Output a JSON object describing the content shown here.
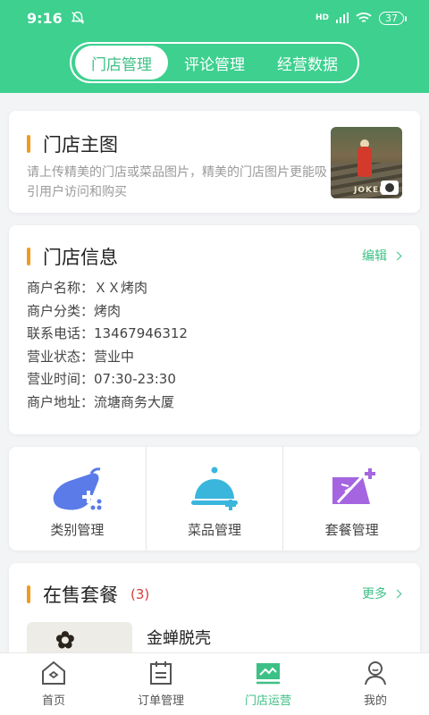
{
  "status_bar": {
    "time": "9:16",
    "battery": "37",
    "network": "HD"
  },
  "header": {
    "tabs": [
      {
        "label": "门店管理",
        "active": true
      },
      {
        "label": "评论管理",
        "active": false
      },
      {
        "label": "经营数据",
        "active": false
      }
    ]
  },
  "store_photo": {
    "title": "门店主图",
    "description": "请上传精美的门店或菜品图片，精美的门店图片更能吸引用户访问和购买",
    "thumb_text": "JOKER"
  },
  "store_info": {
    "title": "门店信息",
    "edit_label": "编辑",
    "rows": [
      "商户名称：ＸＸ烤肉",
      "商户分类：烤肉",
      "联系电话：13467946312",
      "营业状态：营业中",
      "营业时间：07:30-23:30",
      "商户地址：流塘商务大厦"
    ]
  },
  "menu": [
    {
      "label": "类别管理",
      "icon": "category-eggplant-icon"
    },
    {
      "label": "菜品管理",
      "icon": "dish-cloche-icon"
    },
    {
      "label": "套餐管理",
      "icon": "combo-package-icon"
    }
  ],
  "on_sale": {
    "title": "在售套餐",
    "count": "(3)",
    "more_label": "更多",
    "items": [
      {
        "name": "金蝉脱壳"
      }
    ]
  },
  "tabbar": [
    {
      "label": "首页",
      "icon": "home-icon",
      "active": false
    },
    {
      "label": "订单管理",
      "icon": "order-calendar-icon",
      "active": false
    },
    {
      "label": "门店运营",
      "icon": "store-operation-icon",
      "active": true
    },
    {
      "label": "我的",
      "icon": "profile-icon",
      "active": false
    }
  ],
  "colors": {
    "primary": "#3dd08f",
    "accent_bar": "#f39a1e",
    "count": "#d83a3a",
    "link": "#3dc086"
  }
}
